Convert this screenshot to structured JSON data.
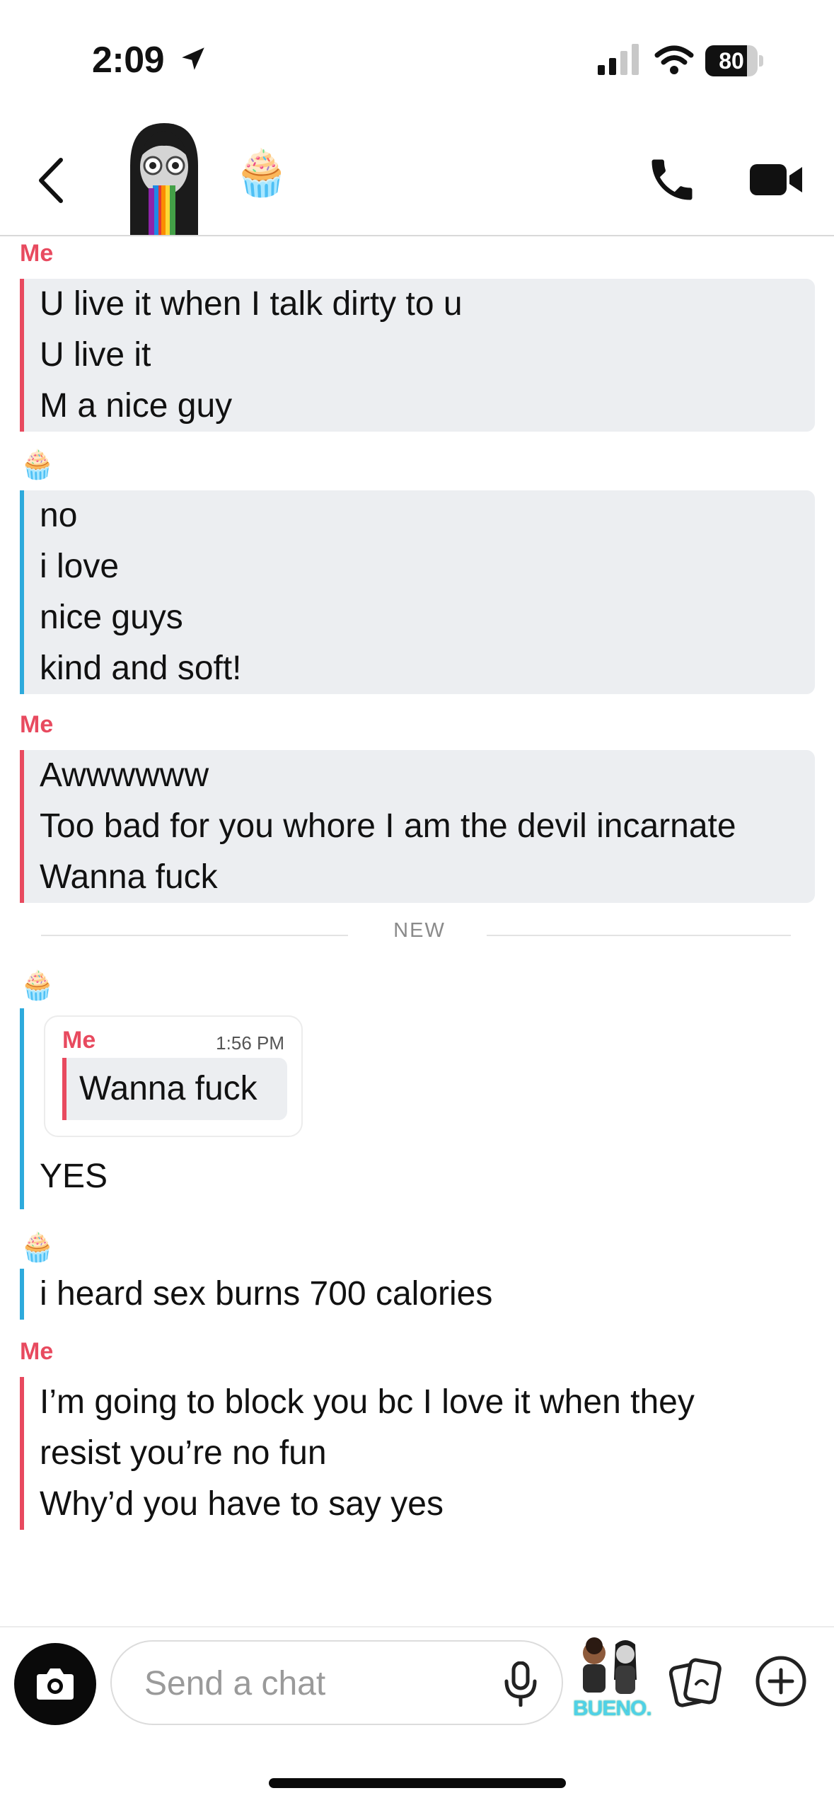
{
  "status_bar": {
    "time": "2:09",
    "battery": "80",
    "battery_level": 0.8
  },
  "header": {
    "contact_emoji": "🧁"
  },
  "chat": {
    "me_label": "Me",
    "them_emoji": "🧁",
    "messages": [
      {
        "sender": "Me",
        "lines": [
          "U live it when I talk dirty to u",
          "U live it",
          "M a nice guy"
        ]
      },
      {
        "sender": "🧁",
        "lines": [
          "no",
          "i love",
          "nice guys",
          "kind and soft!"
        ]
      },
      {
        "sender": "Me",
        "lines": [
          "Awwwwww",
          "Too bad for you whore I am the devil incarnate",
          "Wanna fuck"
        ]
      }
    ],
    "new_divider": "NEW",
    "reply": {
      "sender_emoji": "🧁",
      "quote": {
        "sender": "Me",
        "time": "1:56 PM",
        "text": "Wanna fuck"
      },
      "text": "YES"
    },
    "messages_after": [
      {
        "sender": "🧁",
        "lines": [
          "i heard sex burns 700 calories"
        ]
      },
      {
        "sender": "Me",
        "lines": [
          "I’m going to block you bc I love it when they",
          "resist you’re no fun",
          "Why’d you have to say yes"
        ]
      }
    ]
  },
  "input_bar": {
    "placeholder": "Send a chat",
    "bitmoji_label": "BUENO."
  },
  "colors": {
    "me": "#e84a5f",
    "them": "#2eaadc",
    "bubble_bg": "#eceef1"
  }
}
